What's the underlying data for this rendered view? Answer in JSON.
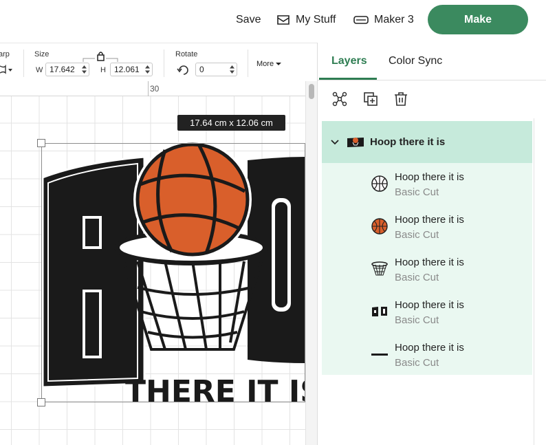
{
  "topbar": {
    "save": "Save",
    "my_stuff": "My Stuff",
    "machine": "Maker 3",
    "make": "Make"
  },
  "toolbar": {
    "warp_label": "arp",
    "size_label": "Size",
    "w_label": "W",
    "w_value": "17.642",
    "h_label": "H",
    "h_value": "12.061",
    "rotate_label": "Rotate",
    "rotate_value": "0",
    "more_label": "More"
  },
  "canvas": {
    "ruler_label": "30",
    "dimension_tip": "17.64  cm x 12.06  cm",
    "artwork_text": "THERE IT IS"
  },
  "panel": {
    "tabs": [
      {
        "label": "Layers",
        "active": true
      },
      {
        "label": "Color Sync",
        "active": false
      }
    ],
    "group": {
      "title": "Hoop there it is"
    },
    "layers": [
      {
        "name": "Hoop there it is",
        "type": "Basic Cut",
        "thumb": "basketball-outline-icon"
      },
      {
        "name": "Hoop there it is",
        "type": "Basic Cut",
        "thumb": "basketball-color-icon"
      },
      {
        "name": "Hoop there it is",
        "type": "Basic Cut",
        "thumb": "hoop-net-icon"
      },
      {
        "name": "Hoop there it is",
        "type": "Basic Cut",
        "thumb": "letters-icon"
      },
      {
        "name": "Hoop there it is",
        "type": "Basic Cut",
        "thumb": "small-text-icon"
      }
    ]
  },
  "colors": {
    "accent": "#2e7d52",
    "make_button": "#3b8a5f",
    "group_bg": "#c6eadb",
    "layer_bg": "#eaf8f1",
    "ball": "#d95f2b"
  }
}
